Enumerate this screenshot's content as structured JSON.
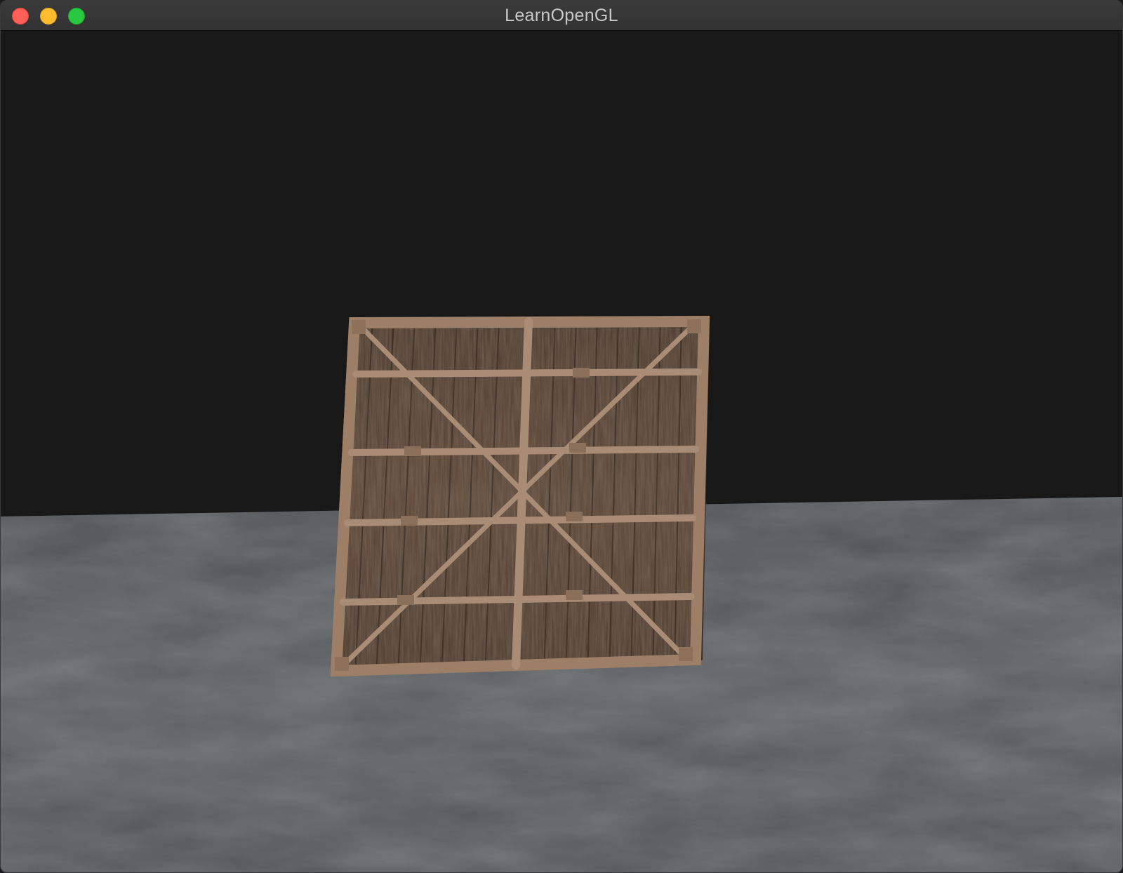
{
  "window": {
    "title": "LearnOpenGL"
  },
  "scene": {
    "clear_color": "#181818",
    "floor_color": "#56585a",
    "crate_wood_color": "#5a4536",
    "crate_frame_color": "#a88b74"
  },
  "icons": {
    "close": "close-button",
    "minimize": "minimize-button",
    "maximize": "maximize-button"
  }
}
